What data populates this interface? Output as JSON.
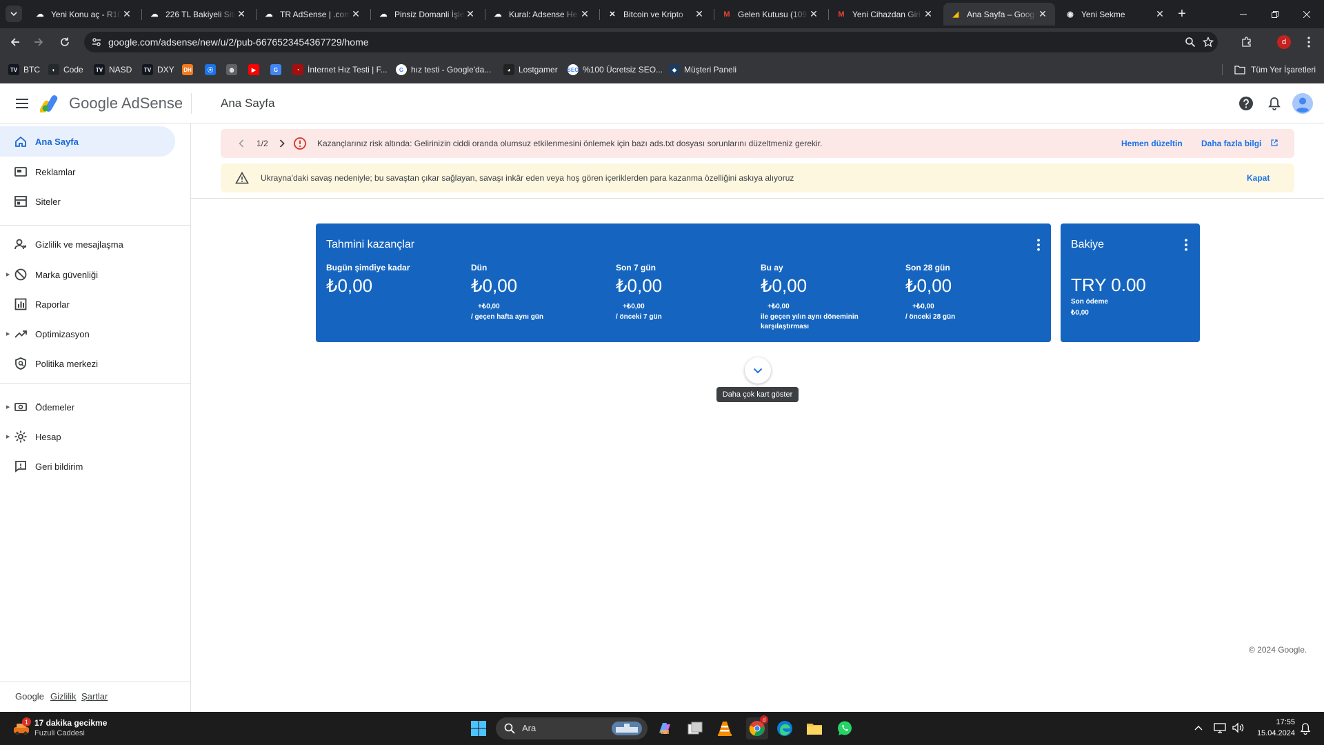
{
  "browser": {
    "tabs": [
      {
        "title": "Yeni Konu aç - R10",
        "icon": "r10-icon"
      },
      {
        "title": "226 TL Bakiyeli Site",
        "icon": "r10-icon"
      },
      {
        "title": "TR AdSense | .com",
        "icon": "r10-icon"
      },
      {
        "title": "Pinsiz Domanli İşle",
        "icon": "r10-icon"
      },
      {
        "title": "Kural: Adsense He",
        "icon": "r10-icon"
      },
      {
        "title": "Bitcoin ve Kripto",
        "icon": "x-brand-icon"
      },
      {
        "title": "Gelen Kutusu (109",
        "icon": "gmail-icon"
      },
      {
        "title": "Yeni Cihazdan Giri",
        "icon": "gmail-icon"
      },
      {
        "title": "Ana Sayfa – Goog",
        "icon": "adsense-icon",
        "active": true
      },
      {
        "title": "Yeni Sekme",
        "icon": "chrome-icon"
      }
    ],
    "url": "google.com/adsense/new/u/2/pub-6676523454367729/home",
    "profile_initial": "d",
    "bookmarks": [
      {
        "label": "BTC",
        "icon": "tradingview-icon"
      },
      {
        "label": "Code",
        "icon": "github-icon"
      },
      {
        "label": "NASD",
        "icon": "tradingview-icon"
      },
      {
        "label": "DXY",
        "icon": "tradingview-icon"
      },
      {
        "label": "",
        "icon": "dh-icon"
      },
      {
        "label": "",
        "icon": "wireless-icon"
      },
      {
        "label": "",
        "icon": "globe-icon"
      },
      {
        "label": "",
        "icon": "youtube-icon"
      },
      {
        "label": "",
        "icon": "translate-icon"
      },
      {
        "label": "İnternet Hız Testi | F...",
        "icon": "speedometer-icon"
      },
      {
        "label": "hız testi - Google'da...",
        "icon": "google-icon"
      },
      {
        "label": "Lostgamer",
        "icon": "lostgamer-icon"
      },
      {
        "label": "%100 Ücretsiz SEO...",
        "icon": "seo-icon"
      },
      {
        "label": "Müşteri Paneli",
        "icon": "panel-icon"
      }
    ],
    "all_bookmarks_label": "Tüm Yer İşaretleri"
  },
  "header": {
    "brand": "Google AdSense",
    "page_title": "Ana Sayfa"
  },
  "sidebar": {
    "items": [
      {
        "label": "Ana Sayfa",
        "icon": "home-icon",
        "active": true
      },
      {
        "label": "Reklamlar",
        "icon": "ads-icon"
      },
      {
        "label": "Siteler",
        "icon": "sites-icon"
      },
      {
        "label": "Gizlilik ve mesajlaşma",
        "icon": "privacy-icon"
      },
      {
        "label": "Marka güvenliği",
        "icon": "block-icon",
        "expandable": true
      },
      {
        "label": "Raporlar",
        "icon": "reports-icon"
      },
      {
        "label": "Optimizasyon",
        "icon": "trending-icon",
        "expandable": true
      },
      {
        "label": "Politika merkezi",
        "icon": "policy-icon"
      },
      {
        "label": "Ödemeler",
        "icon": "payments-icon",
        "expandable": true
      },
      {
        "label": "Hesap",
        "icon": "settings-icon",
        "expandable": true
      },
      {
        "label": "Geri bildirim",
        "icon": "feedback-icon"
      }
    ],
    "footer": {
      "google": "Google",
      "privacy": "Gizlilik",
      "terms": "Şartlar"
    }
  },
  "alerts": {
    "risk": {
      "pager": "1/2",
      "text": "Kazançlarınız risk altında: Gelirinizin ciddi oranda olumsuz etkilenmesini önlemek için bazı ads.txt dosyası sorunlarını düzeltmeniz gerekir.",
      "fix_label": "Hemen düzeltin",
      "more_label": "Daha fazla bilgi"
    },
    "ukraine": {
      "text": "Ukrayna'daki savaş nedeniyle; bu savaştan çıkar sağlayan, savaşı inkâr eden veya hoş gören içeriklerden para kazanma özelliğini askıya alıyoruz",
      "close_label": "Kapat"
    }
  },
  "earnings_card": {
    "title": "Tahmini kazançlar",
    "metrics": [
      {
        "label": "Bugün şimdiye kadar",
        "value": "₺0,00",
        "delta": "",
        "comparison": ""
      },
      {
        "label": "Dün",
        "value": "₺0,00",
        "delta": "+₺0,00",
        "comparison": "/ geçen hafta aynı gün"
      },
      {
        "label": "Son 7 gün",
        "value": "₺0,00",
        "delta": "+₺0,00",
        "comparison": "/ önceki 7 gün"
      },
      {
        "label": "Bu ay",
        "value": "₺0,00",
        "delta": "+₺0,00",
        "comparison": "ile geçen yılın aynı döneminin karşılaştırması"
      },
      {
        "label": "Son 28 gün",
        "value": "₺0,00",
        "delta": "+₺0,00",
        "comparison": "/ önceki 28 gün"
      }
    ]
  },
  "balance_card": {
    "title": "Bakiye",
    "value": "TRY 0.00",
    "last_payment_label": "Son ödeme",
    "last_payment_value": "₺0,00"
  },
  "more_cards_tooltip": "Daha çok kart göster",
  "copyright": "© 2024 Google.",
  "taskbar": {
    "weather_badge": "1",
    "weather_title": "17 dakika gecikme",
    "weather_subtitle": "Fuzuli Caddesi",
    "search_placeholder": "Ara",
    "time": "17:55",
    "date": "15.04.2024"
  }
}
